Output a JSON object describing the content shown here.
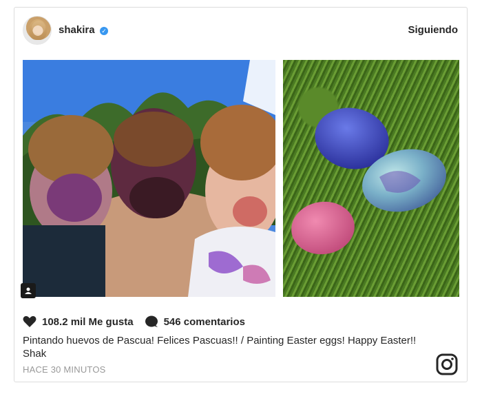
{
  "post": {
    "username": "shakira",
    "verified_mark": "✓",
    "follow_status": "Siguiendo",
    "likes_text": "108.2 mil Me gusta",
    "comments_text": "546 comentarios",
    "caption": "Pintando huevos de Pascua! Felices Pascuas!! / Painting Easter eggs! Happy Easter!! Shak",
    "timestamp": "HACE 30 MINUTOS"
  },
  "icons": {
    "verified": "verified-badge-icon",
    "user_tag": "user-tag-icon",
    "like": "heart-icon",
    "comment": "comment-bubble-icon",
    "brand": "instagram-logo-icon"
  },
  "colors": {
    "verified_blue": "#3897f0",
    "text": "#262626",
    "muted": "#999999",
    "border": "#dcdcdc"
  }
}
